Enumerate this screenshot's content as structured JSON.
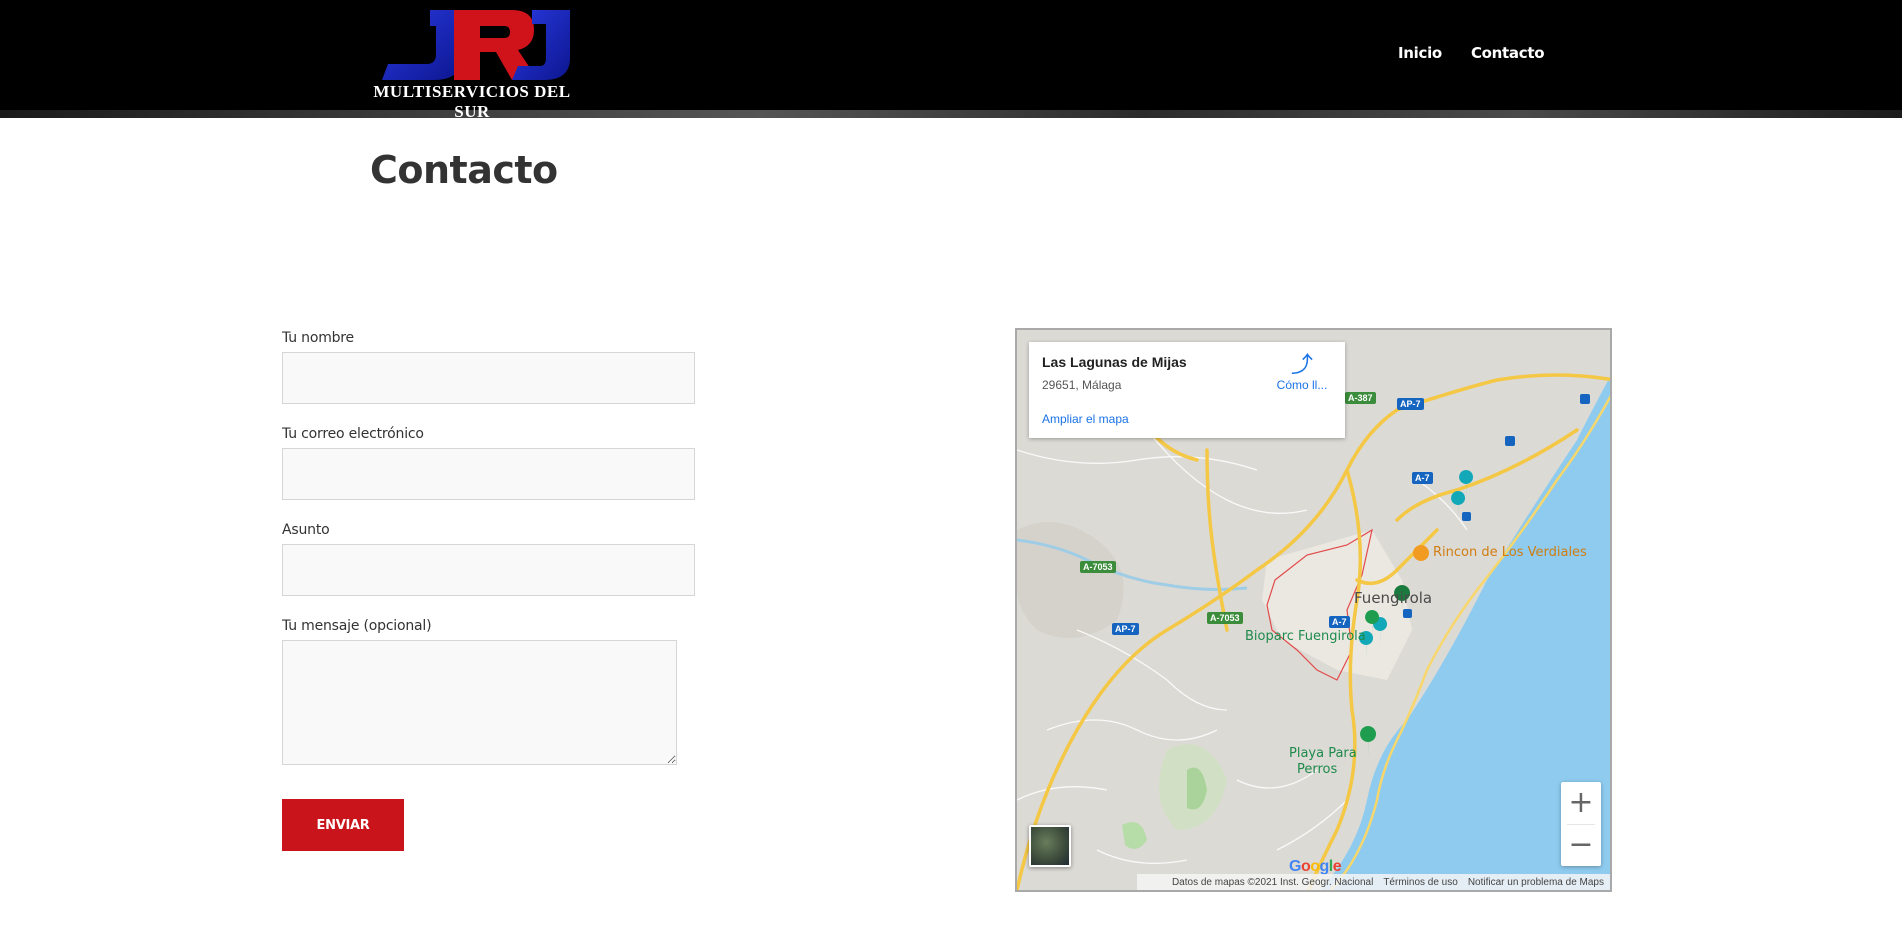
{
  "header": {
    "logo_text": "JRJ",
    "logo_tagline": "MULTISERVICIOS DEL SUR",
    "nav": [
      {
        "label": "Inicio"
      },
      {
        "label": "Contacto"
      }
    ]
  },
  "page": {
    "title": "Contacto"
  },
  "form": {
    "name_label": "Tu nombre",
    "email_label": "Tu correo electrónico",
    "subject_label": "Asunto",
    "message_label": "Tu mensaje (opcional)",
    "submit_label": "ENVIAR"
  },
  "map": {
    "place_name": "Las Lagunas de Mijas",
    "place_address": "29651, Málaga",
    "expand_link": "Ampliar el mapa",
    "directions_label": "Cómo ll...",
    "labels": {
      "restaurant": "Rincon de Los Verdiales",
      "city": "Fuengirola",
      "bioparc": "Bioparc Fuengirola",
      "beach_line1": "Playa Para",
      "beach_line2": "Perros"
    },
    "roads": {
      "a7053_a": "A-7053",
      "a7053_b": "A-7053",
      "ap7_a": "AP-7",
      "ap7_b": "AP-7",
      "a7_a": "A-7",
      "a7_b": "A-7",
      "a387": "A-387"
    },
    "zoom_in": "+",
    "zoom_out": "−",
    "google": "Google",
    "attribution": "Datos de mapas ©2021 Inst. Geogr. Nacional",
    "terms": "Términos de uso",
    "report": "Notificar un problema de Maps"
  },
  "colors": {
    "header_bg": "#000000",
    "accent": "#c8141a",
    "logo_blue": "#1f2ec4",
    "logo_red": "#d0121b",
    "link_blue": "#1a73e8",
    "sea": "#8ecbef"
  }
}
